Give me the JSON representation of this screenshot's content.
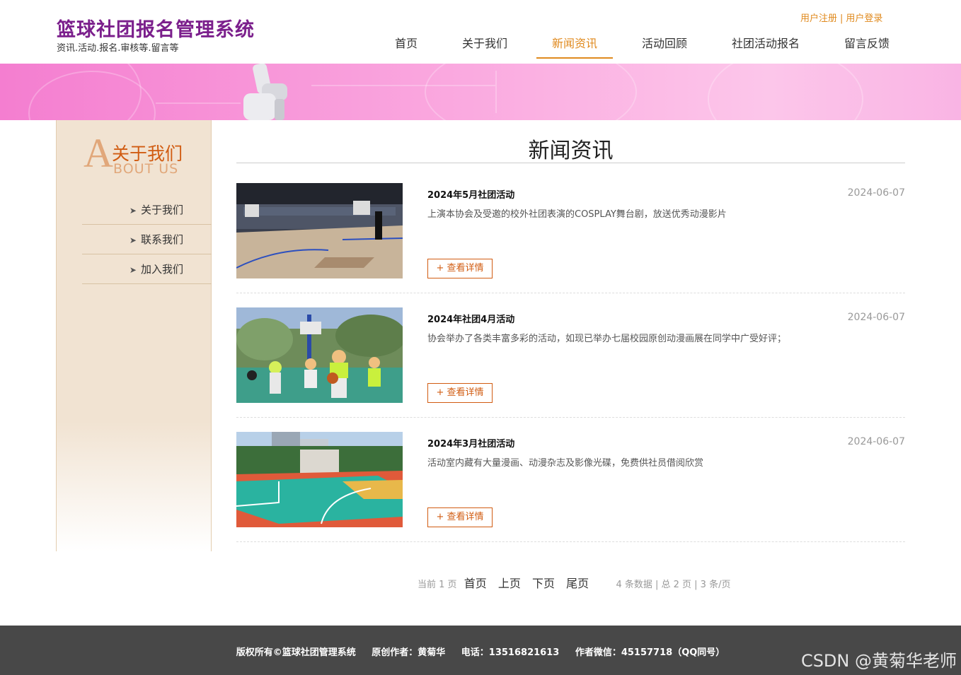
{
  "header": {
    "title": "篮球社团报名管理系统",
    "subtitle": "资讯.活动.报名.审核等.留言等",
    "register": "用户注册",
    "separator": "|",
    "login": "用户登录",
    "nav": [
      {
        "label": "首页"
      },
      {
        "label": "关于我们"
      },
      {
        "label": "新闻资讯"
      },
      {
        "label": "活动回顾"
      },
      {
        "label": "社团活动报名"
      },
      {
        "label": "留言反馈"
      }
    ],
    "active_nav": "新闻资讯"
  },
  "sidebar": {
    "big_letter": "A",
    "title_cn": "关于我们",
    "title_en": "BOUT US",
    "items": [
      {
        "label": "关于我们"
      },
      {
        "label": "联系我们"
      },
      {
        "label": "加入我们"
      }
    ]
  },
  "main": {
    "title": "新闻资讯",
    "news": [
      {
        "title": "2024年5月社团活动",
        "date": "2024-06-07",
        "desc": "上演本协会及受邀的校外社团表演的COSPLAY舞台剧，放送优秀动漫影片",
        "button": "+ 查看详情"
      },
      {
        "title": "2024年社团4月活动",
        "date": "2024-06-07",
        "desc": "协会举办了各类丰富多彩的活动，如现已举办七届校园原创动漫画展在同学中广受好评；",
        "button": "+ 查看详情"
      },
      {
        "title": "2024年3月社团活动",
        "date": "2024-06-07",
        "desc": "活动室内藏有大量漫画、动漫杂志及影像光碟，免费供社员借阅欣赏",
        "button": "+ 查看详情"
      }
    ]
  },
  "pager": {
    "current": "当前 1 页",
    "first": "首页",
    "prev": "上页",
    "next": "下页",
    "last": "尾页",
    "summary": "4 条数据 | 总 2 页 | 3 条/页"
  },
  "footer": {
    "copyright": "版权所有©篮球社团管理系统",
    "author": "原创作者：黄菊华",
    "phone": "电话：13516821613",
    "wechat": "作者微信：45157718（QQ同号）",
    "watermark": "CSDN @黄菊华老师"
  },
  "colors": {
    "brand": "#7b1f8c",
    "accent": "#e08a1e",
    "button": "#d15c12",
    "footer_bg": "#484848"
  }
}
